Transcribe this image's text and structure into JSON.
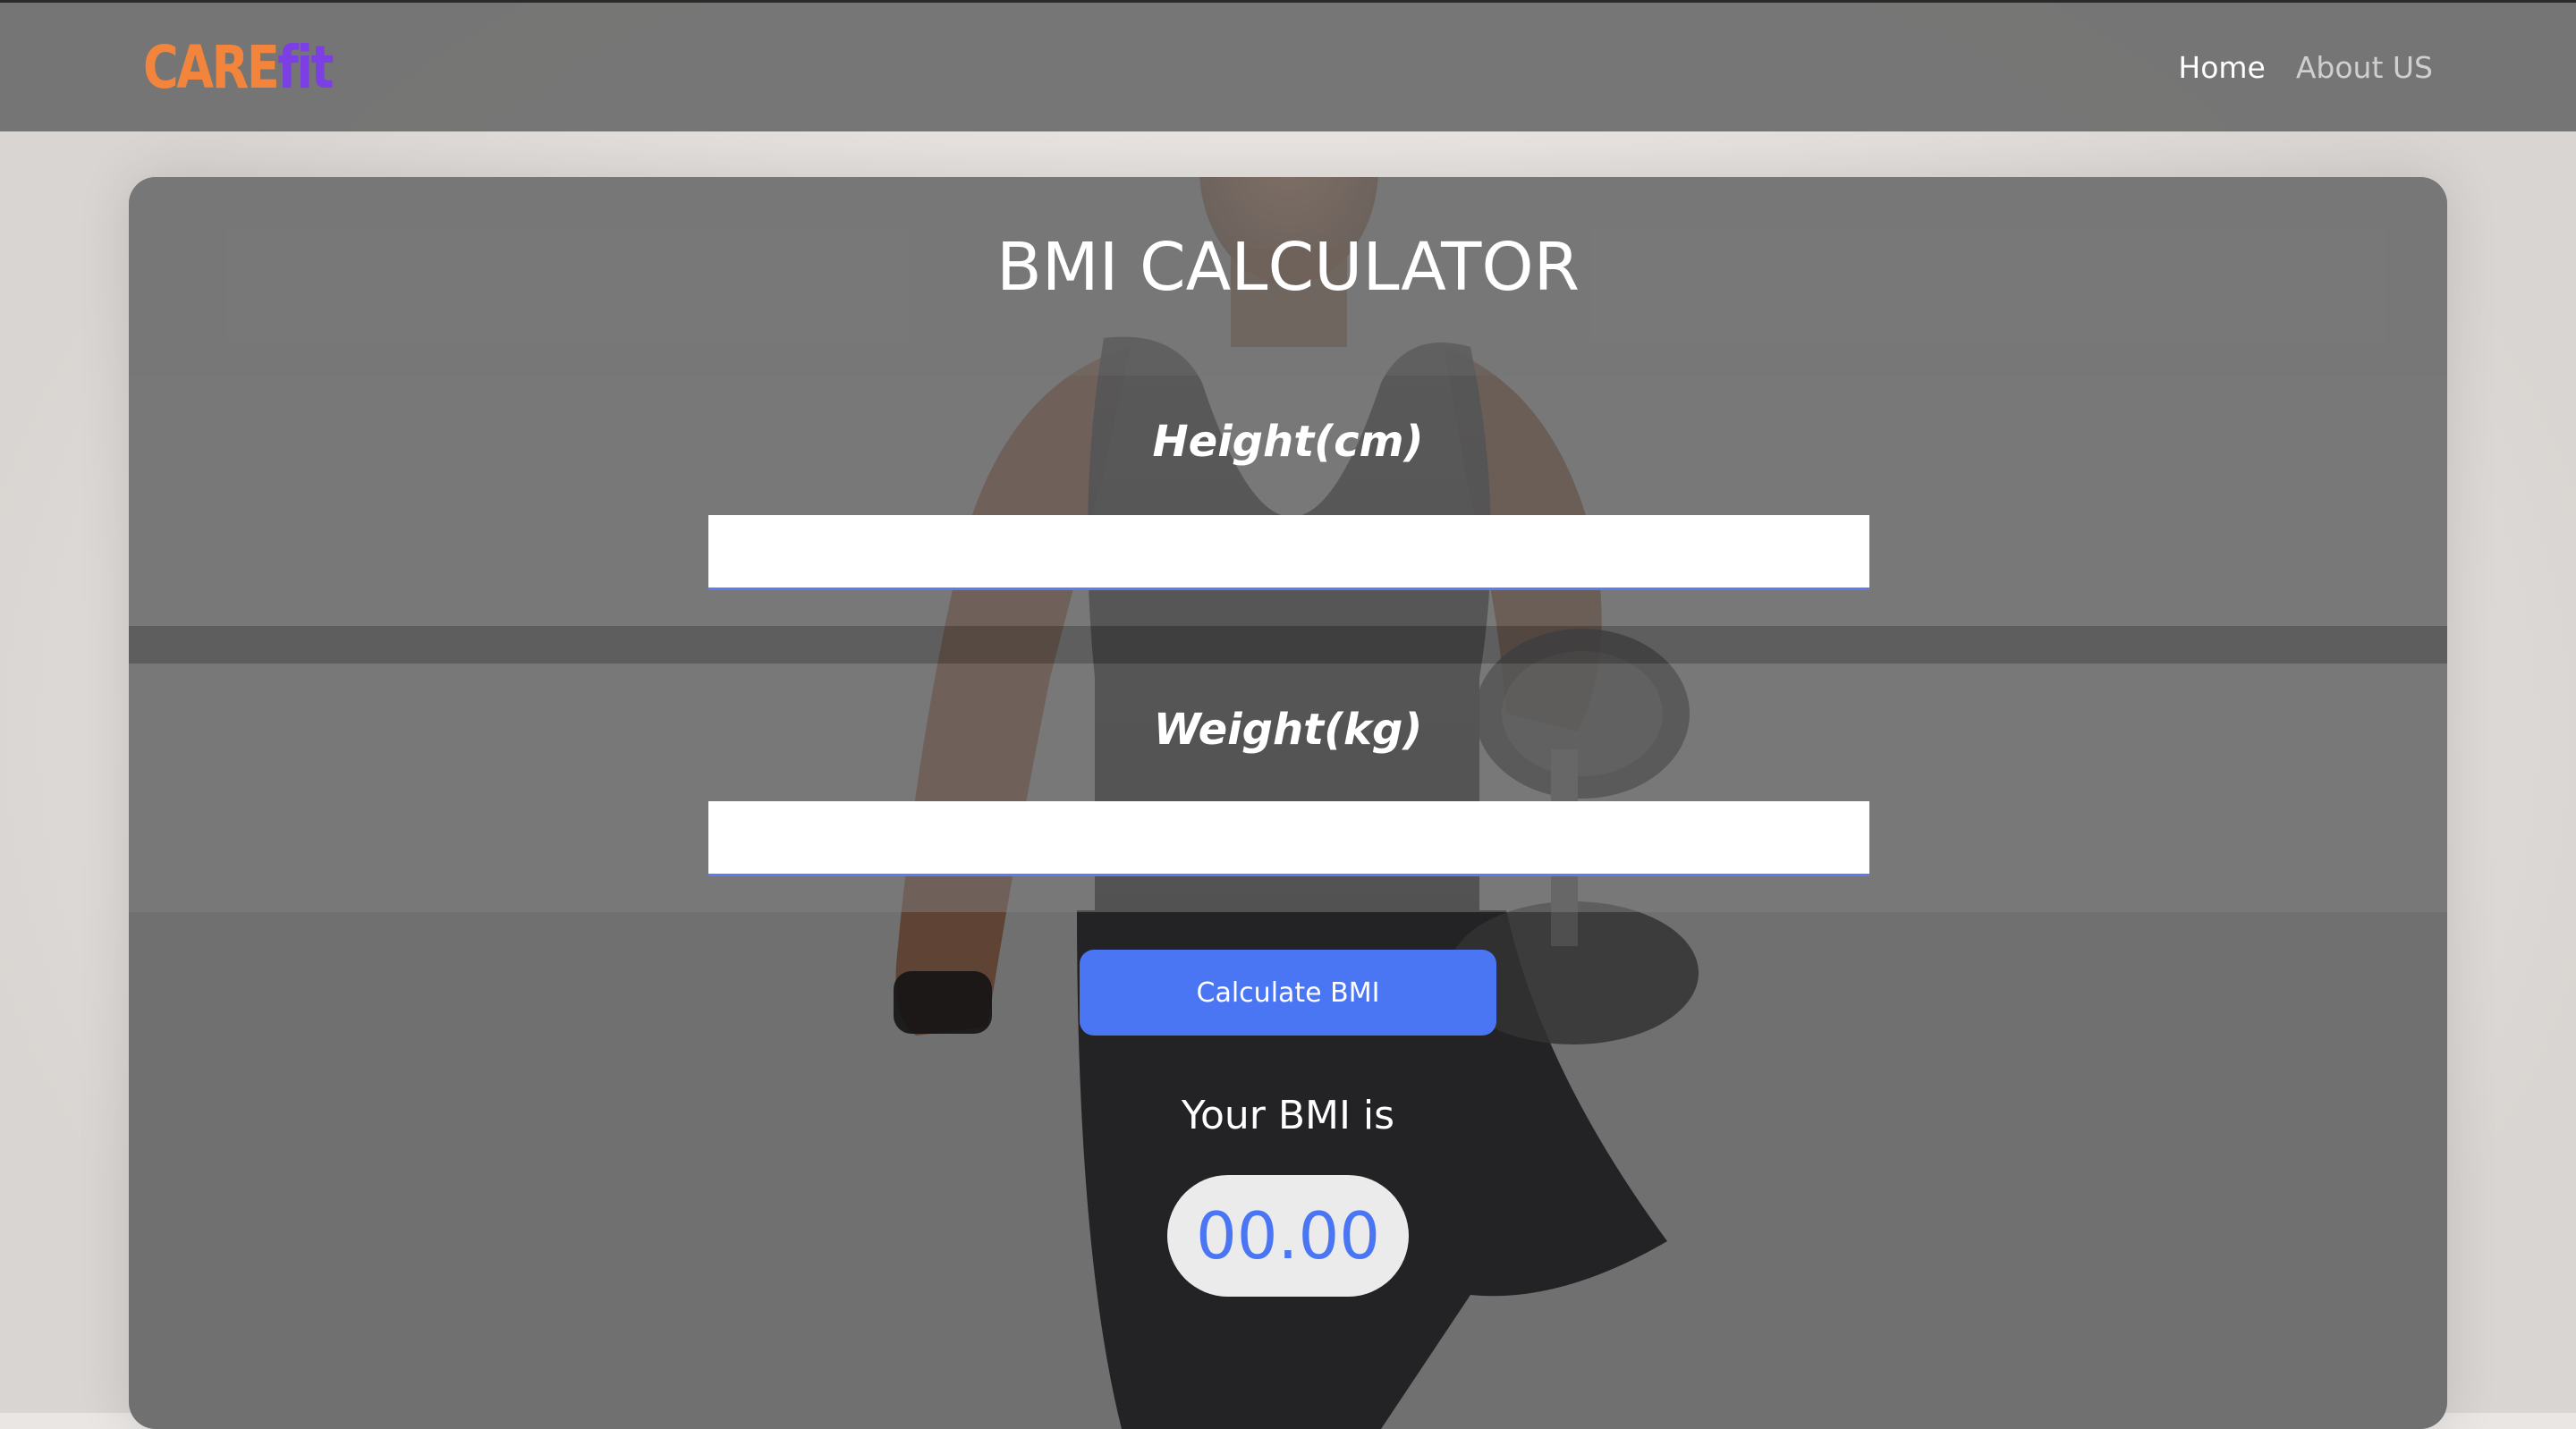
{
  "navbar": {
    "brand_part1": "CARE",
    "brand_part2": "fit",
    "links": [
      {
        "label": "Home",
        "active": true
      },
      {
        "label": "About US",
        "active": false
      }
    ]
  },
  "calculator": {
    "title": "BMI CALCULATOR",
    "height_label": "Height(cm)",
    "height_value": "",
    "weight_label": "Weight(kg)",
    "weight_value": "",
    "button_label": "Calculate BMI",
    "result_label": "Your BMI is",
    "result_value": "00.00"
  },
  "colors": {
    "brand_orange": "#f2843c",
    "brand_purple": "#7b3fe4",
    "accent_blue": "#4a76f3",
    "navbar_bg": "#6e6e6e",
    "panel_bg": "#707070"
  }
}
